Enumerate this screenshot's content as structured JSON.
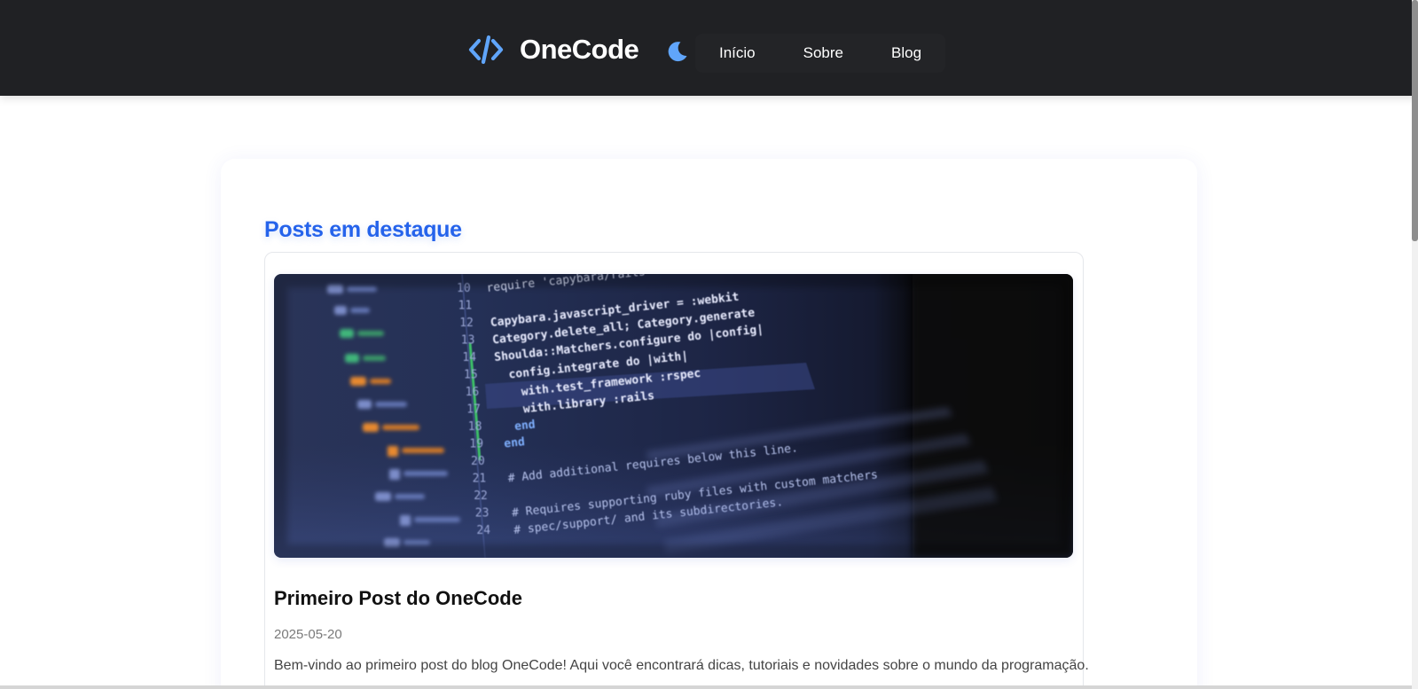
{
  "header": {
    "brand_name": "OneCode",
    "brand_icon": "code-brackets-icon",
    "theme_toggle_icon": "moon-icon",
    "nav": [
      {
        "label": "Início"
      },
      {
        "label": "Sobre"
      },
      {
        "label": "Blog"
      }
    ]
  },
  "main": {
    "section_title": "Posts em destaque",
    "posts": [
      {
        "image_icon": "code-editor-photo",
        "image_code_lines": [
          {
            "n": "10",
            "code": "require 'capybara/rails'"
          },
          {
            "n": "11",
            "code": ""
          },
          {
            "n": "12",
            "code": "Capybara.javascript_driver = :webkit"
          },
          {
            "n": "13",
            "code": "Category.delete_all; Category.generate"
          },
          {
            "n": "14",
            "code": "Shoulda::Matchers.configure do |config|"
          },
          {
            "n": "15",
            "code": "config.integrate do |with|"
          },
          {
            "n": "16",
            "code": "with.test_framework :rspec"
          },
          {
            "n": "17",
            "code": "with.library :rails"
          },
          {
            "n": "18",
            "code": "end"
          },
          {
            "n": "19",
            "code": "end"
          },
          {
            "n": "20",
            "code": ""
          },
          {
            "n": "21",
            "code": "# Add additional requires below this line."
          },
          {
            "n": "22",
            "code": ""
          },
          {
            "n": "23",
            "code": "# Requires supporting ruby files with custom matchers"
          },
          {
            "n": "24",
            "code": "# spec/support/ and its subdirectories."
          }
        ],
        "title": "Primeiro Post do OneCode",
        "date": "2025-05-20",
        "excerpt": "Bem-vindo ao primeiro post do blog OneCode! Aqui você encontrará dicas, tutoriais e novidades sobre o mundo da programação."
      }
    ]
  },
  "colors": {
    "header_bg": "#202124",
    "accent": "#2563eb",
    "icon_blue": "#60a5fa",
    "text_dark": "#111111",
    "text_muted": "#7a7a7a"
  }
}
